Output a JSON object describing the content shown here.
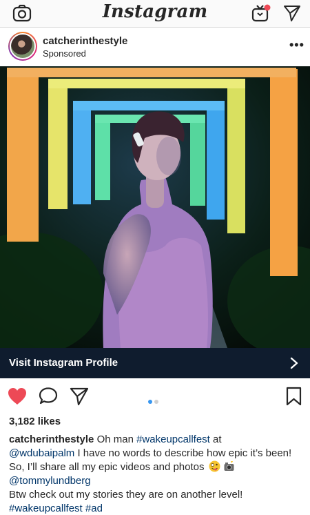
{
  "nav": {
    "logo": "Instagram",
    "icons": [
      "camera-icon",
      "igtv-icon",
      "direct-send-icon"
    ],
    "igtv_badge_color": "#ed4956"
  },
  "post": {
    "username": "catcherinthestyle",
    "sponsored_label": "Sponsored",
    "more_label": "•••",
    "cta_label": "Visit Instagram Profile",
    "cta_color": "#0f1c2e",
    "carousel": {
      "current": 1,
      "total": 2
    },
    "liked": true,
    "like_color": "#ed4956",
    "likes_text": "3,182 likes",
    "caption": {
      "user": "catcherinthestyle",
      "t1": "Oh man ",
      "tag1": "#wakeupcallfest",
      "t2": " at",
      "mention1": "@wdubaipalm",
      "t3": " I have no words to describe how epic it’s been! So, I’ll share all my epic videos and photos ",
      "mention2": "@tommylundberg",
      "t4": "Btw check out my stories they are on another level!",
      "tag2": "#wakeupcallfest",
      "tag3": "#ad",
      "emojis": [
        "zany-face-emoji",
        "camera-flash-emoji"
      ]
    },
    "link_color": "#003569"
  }
}
